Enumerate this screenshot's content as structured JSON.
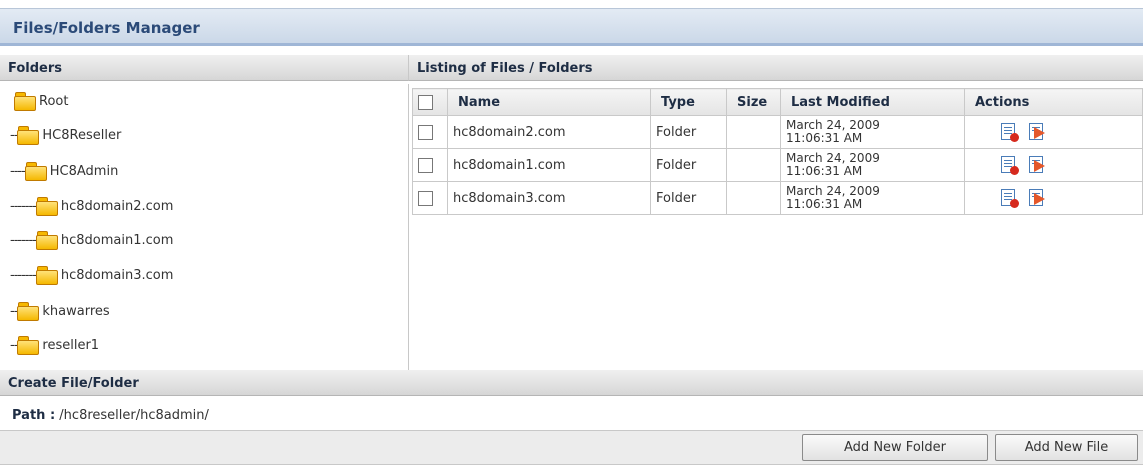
{
  "title": "Files/Folders Manager",
  "folders_panel": {
    "header": "Folders",
    "tree": [
      {
        "prefix": "",
        "label": "Root"
      },
      {
        "prefix": "--",
        "label": "HC8Reseller"
      },
      {
        "prefix": "----",
        "label": "HC8Admin"
      },
      {
        "prefix": "-------",
        "label": "hc8domain2.com"
      },
      {
        "prefix": "-------",
        "label": "hc8domain1.com"
      },
      {
        "prefix": "-------",
        "label": "hc8domain3.com"
      },
      {
        "prefix": "--",
        "label": "khawarres"
      },
      {
        "prefix": "--",
        "label": "reseller1"
      }
    ]
  },
  "listing": {
    "header": "Listing of Files / Folders",
    "columns": [
      "Name",
      "Type",
      "Size",
      "Last Modified",
      "Actions"
    ],
    "rows": [
      {
        "name": "hc8domain2.com",
        "type": "Folder",
        "size": "",
        "modified_date": "March 24, 2009",
        "modified_time": "11:06:31 AM"
      },
      {
        "name": "hc8domain1.com",
        "type": "Folder",
        "size": "",
        "modified_date": "March 24, 2009",
        "modified_time": "11:06:31 AM"
      },
      {
        "name": "hc8domain3.com",
        "type": "Folder",
        "size": "",
        "modified_date": "March 24, 2009",
        "modified_time": "11:06:31 AM"
      }
    ]
  },
  "create": {
    "header": "Create File/Folder",
    "path_label": "Path :",
    "path_value": "/hc8reseller/hc8admin/",
    "add_folder_label": "Add New Folder",
    "add_file_label": "Add New File"
  },
  "icons": {
    "folder": "folder-icon",
    "delete": "delete-icon",
    "open": "open-icon"
  }
}
